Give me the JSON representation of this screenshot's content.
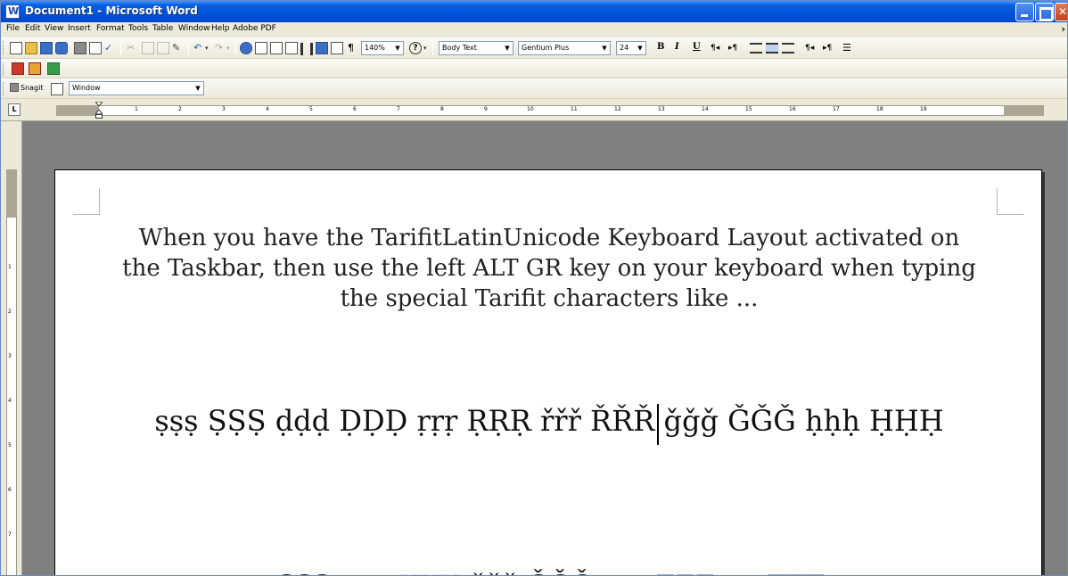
{
  "window": {
    "title": "Document1 - Microsoft Word"
  },
  "menu": {
    "items": [
      "File",
      "Edit",
      "View",
      "Insert",
      "Format",
      "Tools",
      "Table",
      "Window",
      "Help",
      "Adobe PDF"
    ]
  },
  "toolbar": {
    "zoom": "140%",
    "style": "Body Text",
    "font": "Gentium Plus",
    "size": "24",
    "bold": "B",
    "italic": "I",
    "underline": "U",
    "pilcrow": "¶"
  },
  "snagit": {
    "label": "Snagit",
    "capture_mode": "Window"
  },
  "ruler": {
    "numbers": [
      "1",
      "2",
      "3",
      "4",
      "5",
      "6",
      "7",
      "8",
      "9",
      "10",
      "11",
      "12",
      "13",
      "14",
      "15",
      "16",
      "17",
      "18",
      "19"
    ]
  },
  "vruler": {
    "numbers": [
      "1",
      "2",
      "3",
      "4",
      "5",
      "6",
      "7"
    ]
  },
  "document": {
    "paragraph": [
      "When you have the TarifitLatinUnicode Keyboard Layout activated on",
      "the Taskbar, then use the left ALT GR key on your keyboard when typing",
      "the special Tarifit characters like ..."
    ],
    "line1_before_cursor": "ṣṣṣ ṢṢṢ ḍḍḍ ḌḌḌ ṛṛṛ ṚṚṚ řřř ŘŘŘ",
    "line1_after_cursor": " ǧǧǧ ǦǦǦ ḥḥḥ ḤḤḤ",
    "line2_main": "ɛɛɛ ƐƐƐ ɣɣɣ ƔƔƔ ččč ČČČ ẓẓẓ ẒẒẒ ṭṭṭ ṬṬṬ ",
    "line2_sup": "www"
  }
}
